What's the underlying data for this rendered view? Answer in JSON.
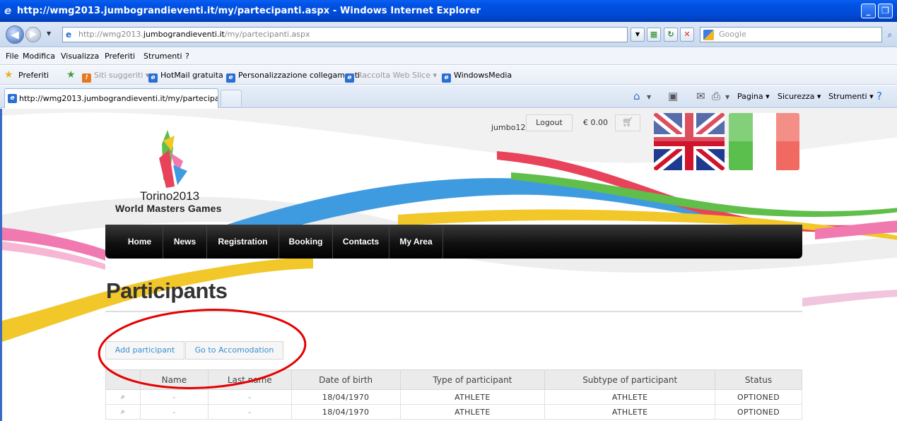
{
  "window": {
    "title": "http://wmg2013.jumbograndieventi.it/my/partecipanti.aspx - Windows Internet Explorer",
    "minimize": "_",
    "restore": "❐"
  },
  "address_bar": {
    "url_prefix": "http://wmg2013.",
    "url_host": "jumbograndieventi.it",
    "url_path": "/my/partecipanti.aspx",
    "search_placeholder": "Google"
  },
  "menu": {
    "items": [
      "File",
      "Modifica",
      "Visualizza",
      "Preferiti",
      "Strumenti",
      "?"
    ]
  },
  "favorites": {
    "label": "Preferiti",
    "links": [
      {
        "label": "Siti suggeriti ▾"
      },
      {
        "label": "HotMail gratuita"
      },
      {
        "label": "Personalizzazione collegamenti"
      },
      {
        "label": "Raccolta Web Slice ▾"
      },
      {
        "label": "WindowsMedia"
      }
    ]
  },
  "tabs": {
    "active_label": "http://wmg2013.jumbograndieventi.it/my/partecipant..."
  },
  "command_bar": {
    "pagina": "Pagina ▾",
    "sicurezza": "Sicurezza ▾",
    "strumenti": "Strumenti ▾"
  },
  "site": {
    "brand": "Torino2013",
    "brand_sub": "World Masters Games",
    "username": "jumbo12",
    "logout": "Logout",
    "cart_total": "€ 0.00",
    "nav": [
      "Home",
      "News",
      "Registration",
      "Booking",
      "Contacts",
      "My Area"
    ]
  },
  "participants": {
    "title": "Participants",
    "add_button": "Add participant",
    "accommodation_button": "Go to Accomodation",
    "columns": [
      "",
      "Name",
      "Last name",
      "Date of birth",
      "Type of participant",
      "Subtype of participant",
      "Status"
    ],
    "rows": [
      {
        "name": "-",
        "last_name": "-",
        "dob": "18/04/1970",
        "type": "ATHLETE",
        "subtype": "ATHLETE",
        "status": "OPTIONED"
      },
      {
        "name": "-",
        "last_name": "-",
        "dob": "18/04/1970",
        "type": "ATHLETE",
        "subtype": "ATHLETE",
        "status": "OPTIONED"
      }
    ]
  },
  "colors": {
    "annotation": "#e60000",
    "nav_bg": "#111111",
    "link": "#3a8ed0"
  }
}
